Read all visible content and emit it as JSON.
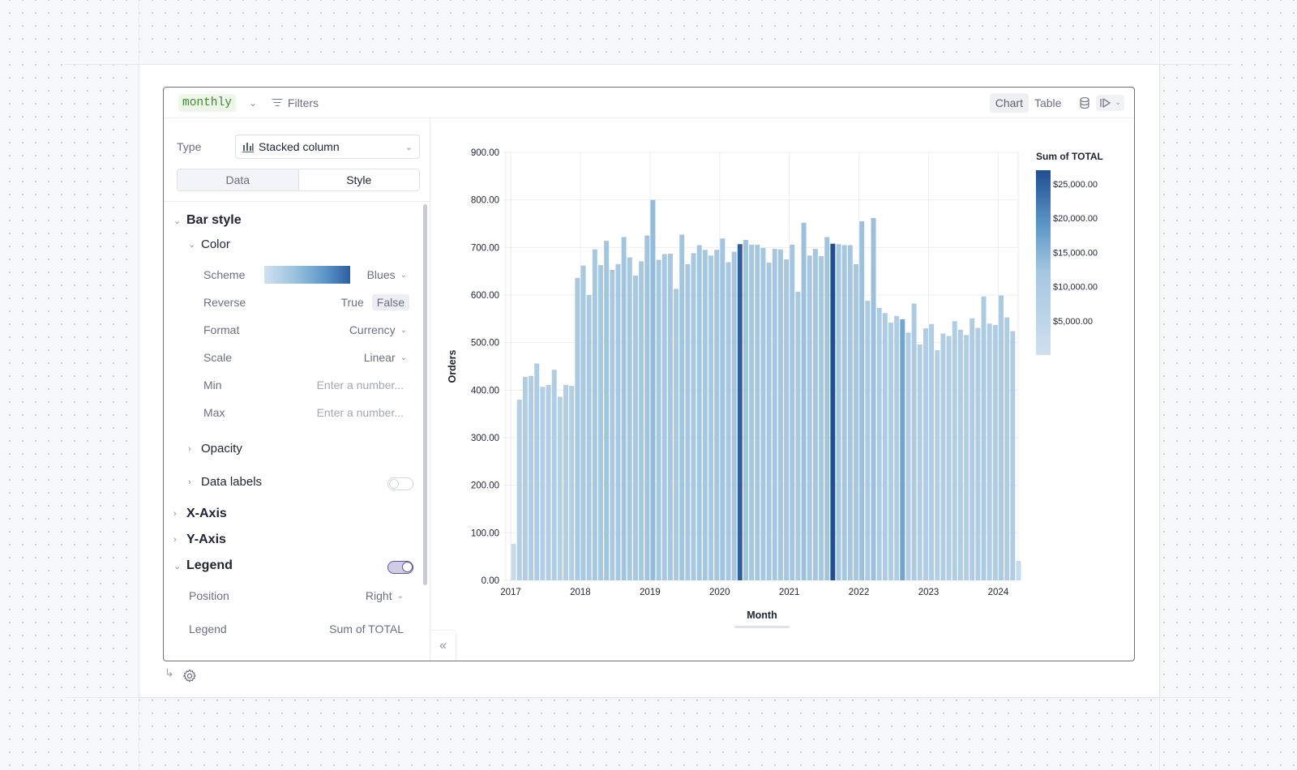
{
  "toolbar": {
    "variable_name": "monthly",
    "filters_label": "Filters",
    "view_tabs": [
      {
        "label": "Chart",
        "active": true
      },
      {
        "label": "Table",
        "active": false
      }
    ]
  },
  "config": {
    "type_label": "Type",
    "type_value": "Stacked column",
    "tabs": [
      {
        "label": "Data",
        "active": false
      },
      {
        "label": "Style",
        "active": true
      }
    ],
    "bar_style": {
      "title": "Bar style",
      "color_title": "Color",
      "scheme_label": "Scheme",
      "scheme_value": "Blues",
      "reverse_label": "Reverse",
      "reverse_options": [
        "True",
        "False"
      ],
      "reverse_selected": "False",
      "format_label": "Format",
      "format_value": "Currency",
      "scale_label": "Scale",
      "scale_value": "Linear",
      "min_label": "Min",
      "min_placeholder": "Enter a number...",
      "max_label": "Max",
      "max_placeholder": "Enter a number...",
      "opacity_label": "Opacity",
      "data_labels_label": "Data labels",
      "data_labels_enabled": false
    },
    "x_axis_title": "X-Axis",
    "y_axis_title": "Y-Axis",
    "legend": {
      "title": "Legend",
      "enabled": true,
      "position_label": "Position",
      "position_value": "Right",
      "legend_label": "Legend",
      "legend_value": "Sum of TOTAL"
    }
  },
  "colors": {
    "accent": "#6e66a8",
    "bar_light": "#cfe0ef",
    "bar_dark": "#1f4e92"
  },
  "chart_data": {
    "type": "bar",
    "subtype": "stacked column",
    "xlabel": "Month",
    "ylabel": "Orders",
    "ylim": [
      0,
      900
    ],
    "yticks": [
      "0.00",
      "100.00",
      "200.00",
      "300.00",
      "400.00",
      "500.00",
      "600.00",
      "700.00",
      "800.00",
      "900.00"
    ],
    "xticks": [
      "2017",
      "2018",
      "2019",
      "2020",
      "2021",
      "2022",
      "2023",
      "2024"
    ],
    "grid": true,
    "legend": {
      "title": "Sum of TOTAL",
      "position": "right",
      "type": "color-gradient",
      "range": [
        0,
        27000
      ],
      "labels": [
        "$25,000.00",
        "$20,000.00",
        "$15,000.00",
        "$10,000.00",
        "$5,000.00"
      ],
      "label_values": [
        25000,
        20000,
        15000,
        10000,
        5000
      ]
    },
    "series": [
      {
        "name": "Orders",
        "start": "2017-01",
        "values": [
          77,
          380,
          428,
          430,
          456,
          407,
          411,
          443,
          386,
          411,
          409,
          636,
          662,
          600,
          696,
          663,
          714,
          653,
          665,
          722,
          679,
          641,
          671,
          725,
          800,
          674,
          686,
          687,
          613,
          727,
          665,
          688,
          705,
          695,
          683,
          695,
          719,
          669,
          691,
          707,
          716,
          706,
          706,
          699,
          668,
          697,
          696,
          675,
          706,
          607,
          752,
          683,
          697,
          682,
          722,
          708,
          707,
          705,
          705,
          665,
          755,
          588,
          762,
          573,
          562,
          542,
          556,
          549,
          521,
          582,
          496,
          530,
          539,
          484,
          519,
          514,
          545,
          527,
          516,
          551,
          531,
          597,
          540,
          537,
          599,
          553,
          524,
          41
        ],
        "color_totals": [
          3000,
          8000,
          9000,
          9000,
          9500,
          8500,
          8600,
          9200,
          8000,
          8600,
          8500,
          11000,
          11500,
          10500,
          12000,
          11500,
          12300,
          11300,
          11500,
          12400,
          11800,
          11200,
          11700,
          12500,
          13800,
          11700,
          11900,
          11900,
          10700,
          12500,
          11500,
          11900,
          12200,
          12000,
          11800,
          12000,
          12400,
          11600,
          12000,
          25000,
          12300,
          12100,
          12100,
          12000,
          11600,
          12000,
          12000,
          11700,
          12200,
          10600,
          13000,
          11800,
          12000,
          11800,
          12400,
          27000,
          12200,
          12100,
          12100,
          11500,
          13000,
          10200,
          13100,
          9900,
          9700,
          9400,
          9600,
          17000,
          9000,
          10000,
          8600,
          9200,
          9300,
          8400,
          9000,
          8900,
          9400,
          9100,
          8900,
          9500,
          9200,
          10300,
          9300,
          9300,
          10300,
          9500,
          9100,
          2500
        ]
      }
    ]
  }
}
